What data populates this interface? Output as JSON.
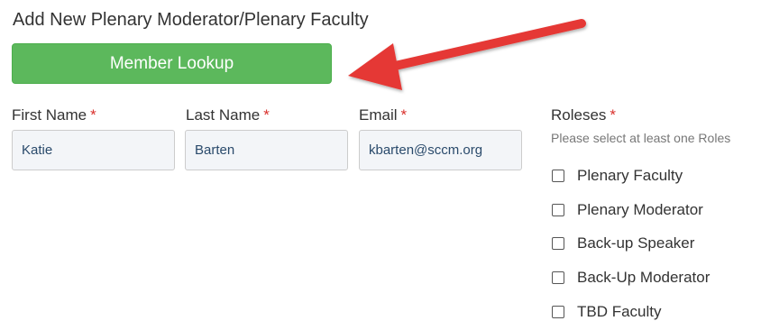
{
  "form": {
    "title": "Add New Plenary Moderator/Plenary Faculty",
    "lookup_button": "Member Lookup",
    "required_marker": "*",
    "first_name": {
      "label": "First Name",
      "value": "Katie"
    },
    "last_name": {
      "label": "Last Name",
      "value": "Barten"
    },
    "email": {
      "label": "Email",
      "value": "kbarten@sccm.org"
    },
    "roles": {
      "label": "Roleses",
      "hint": "Please select at least one Roles",
      "options": [
        {
          "label": "Plenary Faculty",
          "checked": false
        },
        {
          "label": "Plenary Moderator",
          "checked": false
        },
        {
          "label": "Back-up Speaker",
          "checked": false
        },
        {
          "label": "Back-Up Moderator",
          "checked": false
        },
        {
          "label": "TBD Faculty",
          "checked": false
        }
      ]
    }
  },
  "colors": {
    "button_green": "#5cb85c",
    "required_red": "#d9302c",
    "arrow_red": "#e53935",
    "input_bg": "#f3f5f8"
  },
  "annotation": {
    "icon": "red-arrow-icon"
  }
}
